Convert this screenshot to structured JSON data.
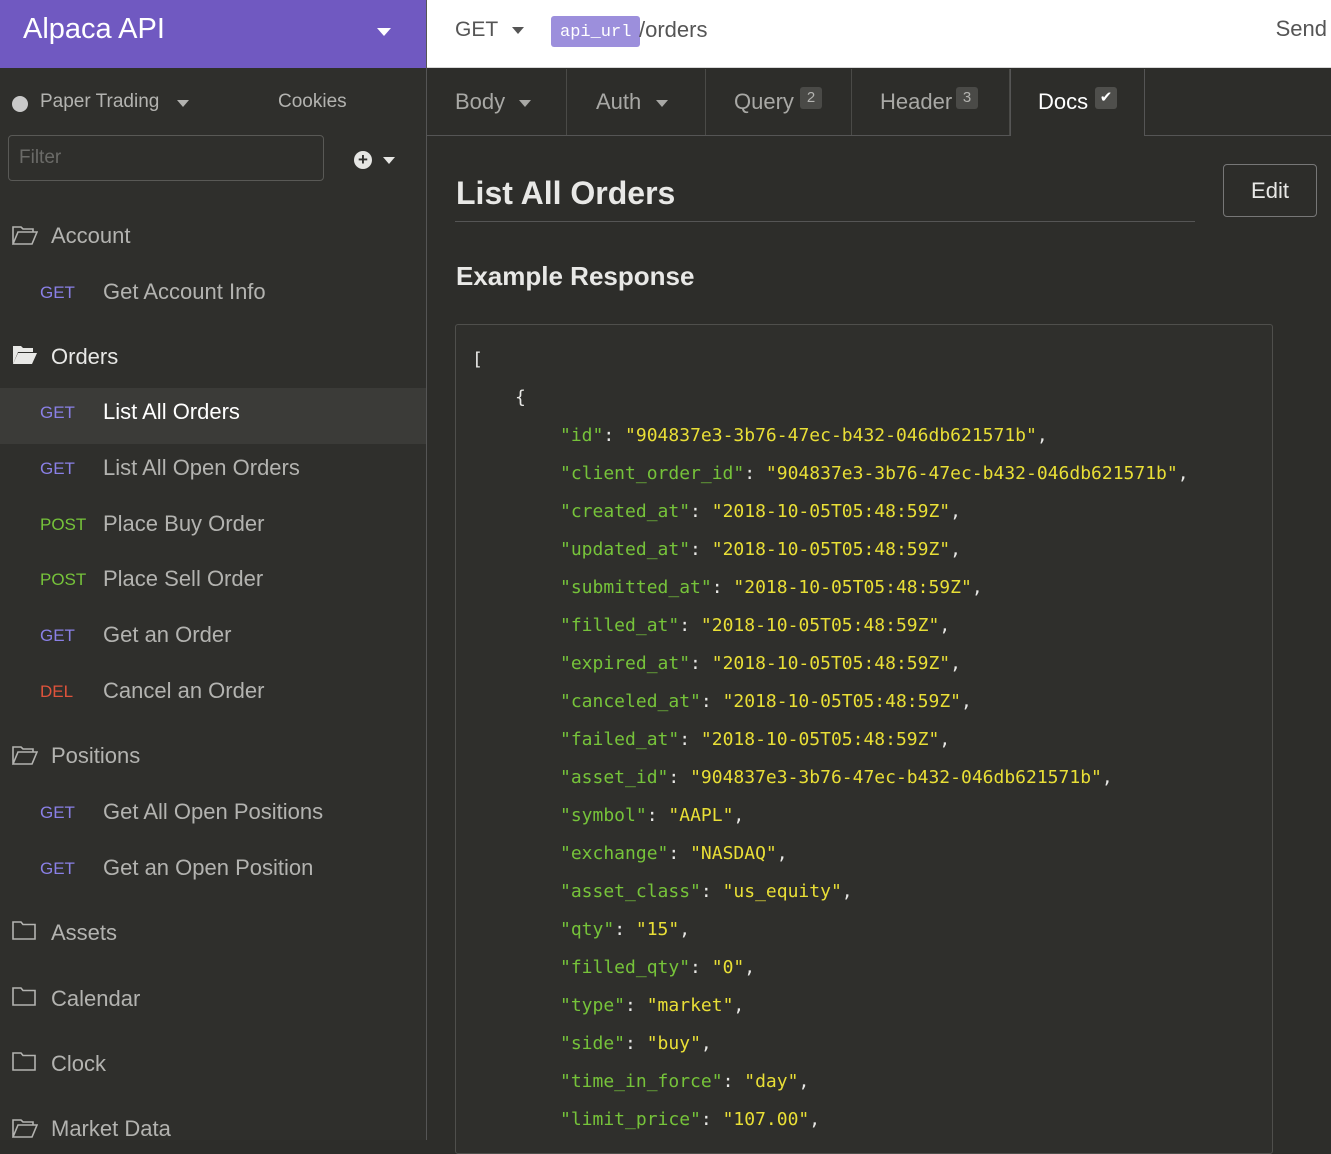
{
  "workspace": {
    "title": "Alpaca API"
  },
  "environment": {
    "label": "Paper Trading",
    "cookies": "Cookies"
  },
  "filter": {
    "placeholder": "Filter"
  },
  "sidebar": {
    "folders": [
      {
        "name": "Account",
        "open": false
      },
      {
        "name": "Orders",
        "open": true
      },
      {
        "name": "Positions",
        "open": false
      },
      {
        "name": "Assets",
        "open": false
      },
      {
        "name": "Calendar",
        "open": false
      },
      {
        "name": "Clock",
        "open": false
      },
      {
        "name": "Market Data",
        "open": false
      }
    ],
    "requests": [
      {
        "method": "GET",
        "label": "Get Account Info"
      },
      {
        "method": "GET",
        "label": "List All Orders"
      },
      {
        "method": "GET",
        "label": "List All Open Orders"
      },
      {
        "method": "POST",
        "label": "Place Buy Order"
      },
      {
        "method": "POST",
        "label": "Place Sell Order"
      },
      {
        "method": "GET",
        "label": "Get an Order"
      },
      {
        "method": "DEL",
        "label": "Cancel an Order"
      },
      {
        "method": "GET",
        "label": "Get All Open Positions"
      },
      {
        "method": "GET",
        "label": "Get an Open Position"
      }
    ]
  },
  "request": {
    "method": "GET",
    "url_variable": "api_url",
    "url_path": "/orders",
    "send_label": "Send"
  },
  "tabs": [
    {
      "label": "Body",
      "badge": ""
    },
    {
      "label": "Auth",
      "badge": ""
    },
    {
      "label": "Query",
      "badge": "2"
    },
    {
      "label": "Header",
      "badge": "3"
    },
    {
      "label": "Docs",
      "badge": "✔"
    }
  ],
  "docs": {
    "title": "List All Orders",
    "edit_label": "Edit",
    "example_heading": "Example Response",
    "open_bracket": "[",
    "open_brace": "{",
    "fields": [
      {
        "key": "id",
        "value": "904837e3-3b76-47ec-b432-046db621571b"
      },
      {
        "key": "client_order_id",
        "value": "904837e3-3b76-47ec-b432-046db621571b"
      },
      {
        "key": "created_at",
        "value": "2018-10-05T05:48:59Z"
      },
      {
        "key": "updated_at",
        "value": "2018-10-05T05:48:59Z"
      },
      {
        "key": "submitted_at",
        "value": "2018-10-05T05:48:59Z"
      },
      {
        "key": "filled_at",
        "value": "2018-10-05T05:48:59Z"
      },
      {
        "key": "expired_at",
        "value": "2018-10-05T05:48:59Z"
      },
      {
        "key": "canceled_at",
        "value": "2018-10-05T05:48:59Z"
      },
      {
        "key": "failed_at",
        "value": "2018-10-05T05:48:59Z"
      },
      {
        "key": "asset_id",
        "value": "904837e3-3b76-47ec-b432-046db621571b"
      },
      {
        "key": "symbol",
        "value": "AAPL"
      },
      {
        "key": "exchange",
        "value": "NASDAQ"
      },
      {
        "key": "asset_class",
        "value": "us_equity"
      },
      {
        "key": "qty",
        "value": "15"
      },
      {
        "key": "filled_qty",
        "value": "0"
      },
      {
        "key": "type",
        "value": "market"
      },
      {
        "key": "side",
        "value": "buy"
      },
      {
        "key": "time_in_force",
        "value": "day"
      },
      {
        "key": "limit_price",
        "value": "107.00"
      }
    ]
  }
}
